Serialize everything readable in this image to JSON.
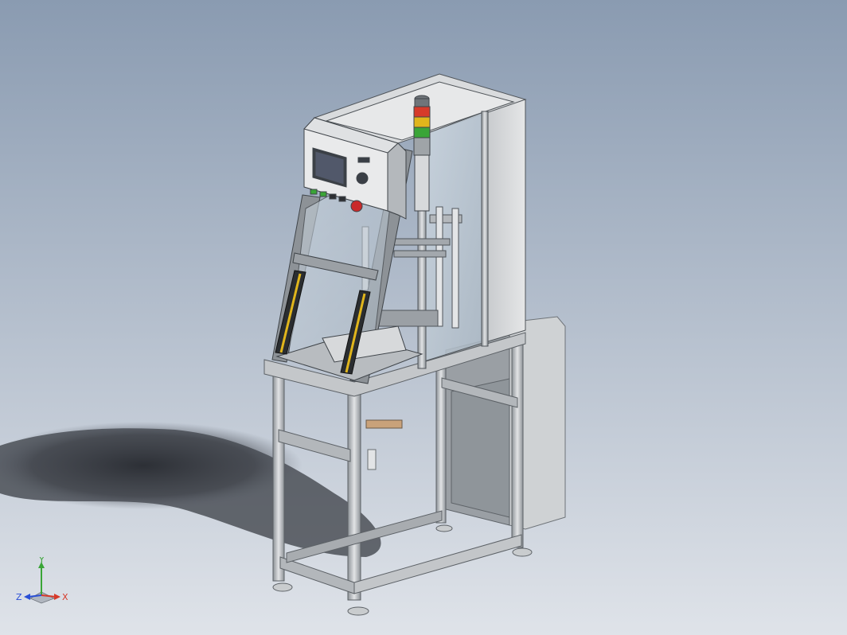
{
  "viewport": {
    "background_top": "#8a9bb1",
    "background_bottom": "#dfe3e9"
  },
  "model": {
    "frame_color": "#b9bec4",
    "panel_color": "#d6d8da",
    "glass_color": "#c6d2dc",
    "stack_light_colors": [
      "#d63a2a",
      "#e0b51c",
      "#3aa537"
    ]
  },
  "triad": {
    "y_label": "Y",
    "x_label": "X",
    "z_label": "Z",
    "y_color": "#3aa537",
    "x_color": "#d63a2a",
    "z_color": "#2a4fd6"
  }
}
